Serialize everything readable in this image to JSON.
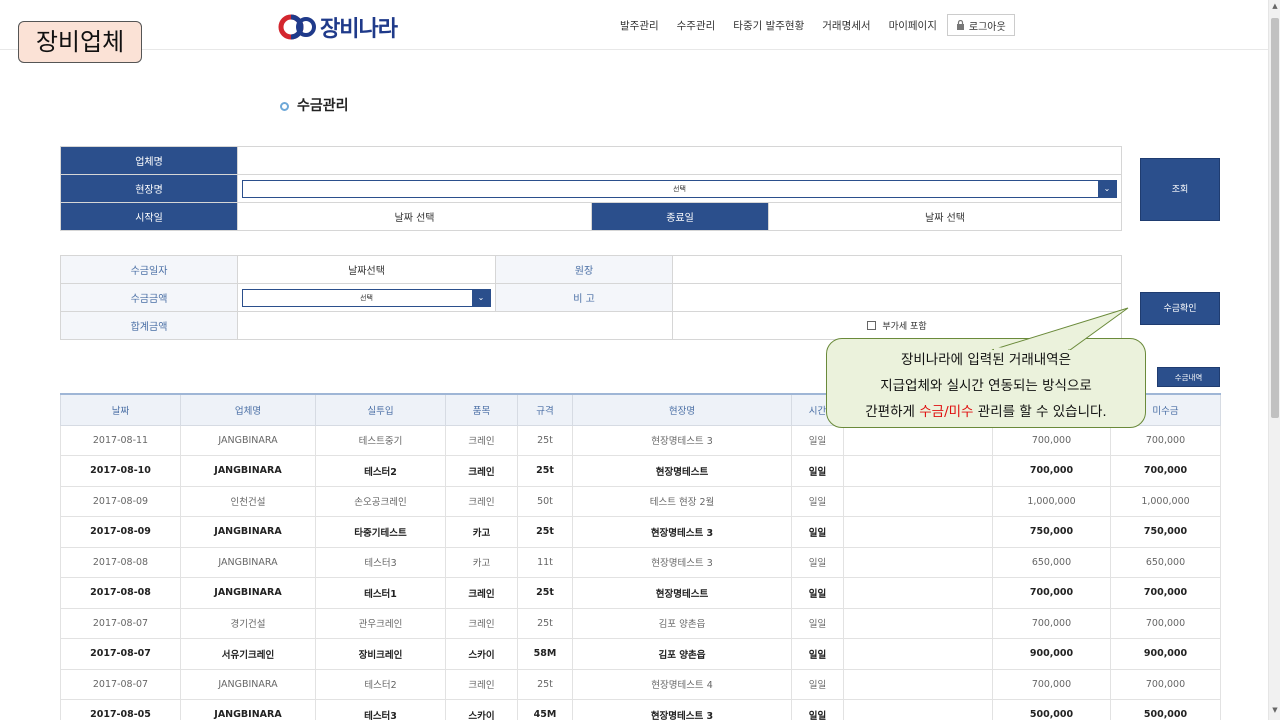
{
  "badge": "장비업체",
  "logo": {
    "prefix": "장비",
    "suffix": "나라"
  },
  "nav": {
    "items": [
      "발주관리",
      "수주관리",
      "타중기 발주현황",
      "거래명세서",
      "마이페이지"
    ],
    "logout": "로그아웃"
  },
  "page_title": "수금관리",
  "search": {
    "company_label": "업체명",
    "site_label": "현장명",
    "site_select": "선택",
    "start_label": "시작일",
    "start_value": "날짜 선택",
    "end_label": "종료일",
    "end_value": "날짜 선택",
    "search_button": "조회"
  },
  "payment": {
    "date_label": "수금일자",
    "date_value": "날짜선택",
    "ledger_label": "원장",
    "amount_label": "수금금액",
    "amount_select": "선택",
    "note_label": "비 고",
    "total_label": "합계금액",
    "vat_label": "부가세 포함",
    "confirm_button": "수금확인",
    "history_button": "수금내역"
  },
  "callout": {
    "line1": "장비나라에 입력된 거래내역은",
    "line2": "지급업체와 실시간 연동되는 방식으로",
    "line3_pre": "간편하게 ",
    "line3_highlight": "수금/미수",
    "line3_post": " 관리를 할 수 있습니다."
  },
  "table": {
    "headers": [
      "날짜",
      "업체명",
      "실투입",
      "품목",
      "규격",
      "현장명",
      "시간",
      "",
      "",
      "미수금"
    ],
    "rows": [
      {
        "bold": false,
        "cells": [
          "2017-08-11",
          "JANGBINARA",
          "테스트중기",
          "크레인",
          "25t",
          "현장명테스트 3",
          "일일",
          "",
          "700,000",
          "700,000"
        ]
      },
      {
        "bold": true,
        "cells": [
          "2017-08-10",
          "JANGBINARA",
          "테스터2",
          "크레인",
          "25t",
          "현장명테스트",
          "일일",
          "",
          "700,000",
          "700,000"
        ]
      },
      {
        "bold": false,
        "cells": [
          "2017-08-09",
          "인천건설",
          "손오공크레인",
          "크레인",
          "50t",
          "테스트 현장 2월",
          "일일",
          "",
          "1,000,000",
          "1,000,000"
        ]
      },
      {
        "bold": true,
        "cells": [
          "2017-08-09",
          "JANGBINARA",
          "타중기테스트",
          "카고",
          "25t",
          "현장명테스트 3",
          "일일",
          "",
          "750,000",
          "750,000"
        ]
      },
      {
        "bold": false,
        "cells": [
          "2017-08-08",
          "JANGBINARA",
          "테스터3",
          "카고",
          "11t",
          "현장명테스트 3",
          "일일",
          "",
          "650,000",
          "650,000"
        ]
      },
      {
        "bold": true,
        "cells": [
          "2017-08-08",
          "JANGBINARA",
          "테스터1",
          "크레인",
          "25t",
          "현장명테스트",
          "일일",
          "",
          "700,000",
          "700,000"
        ]
      },
      {
        "bold": false,
        "cells": [
          "2017-08-07",
          "경기건설",
          "관우크레인",
          "크레인",
          "25t",
          "김포 양촌읍",
          "일일",
          "",
          "700,000",
          "700,000"
        ]
      },
      {
        "bold": true,
        "cells": [
          "2017-08-07",
          "서유기크레인",
          "장비크레인",
          "스카이",
          "58M",
          "김포 양촌읍",
          "일일",
          "",
          "900,000",
          "900,000"
        ]
      },
      {
        "bold": false,
        "cells": [
          "2017-08-07",
          "JANGBINARA",
          "테스터2",
          "크레인",
          "25t",
          "현장명테스트 4",
          "일일",
          "",
          "700,000",
          "700,000"
        ]
      },
      {
        "bold": true,
        "cells": [
          "2017-08-05",
          "JANGBINARA",
          "테스터3",
          "스카이",
          "45M",
          "현장명테스트 3",
          "일일",
          "",
          "500,000",
          "500,000"
        ]
      }
    ]
  }
}
